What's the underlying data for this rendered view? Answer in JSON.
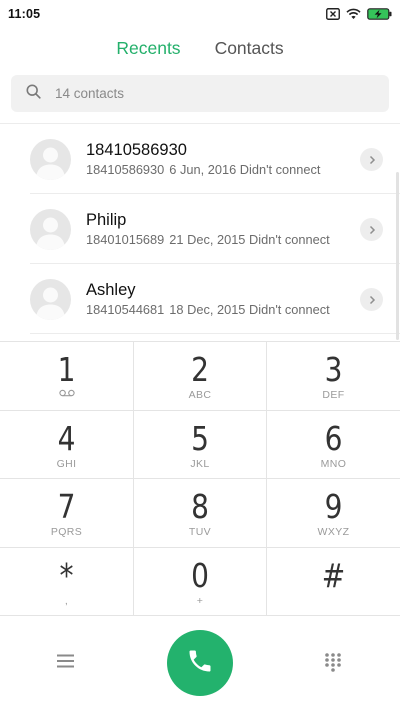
{
  "status_bar": {
    "time": "11:05",
    "icons": [
      "no-sim-icon",
      "wifi-icon",
      "battery-charging-icon"
    ]
  },
  "tabs": [
    {
      "label": "Recents",
      "active": true
    },
    {
      "label": "Contacts",
      "active": false
    }
  ],
  "search": {
    "placeholder": "14 contacts",
    "icon": "search-icon"
  },
  "recents": [
    {
      "name": "18410586930",
      "number": "18410586930",
      "date": "6 Jun, 2016",
      "status": "Didn't connect"
    },
    {
      "name": "Philip",
      "number": "18401015689",
      "date": "21 Dec, 2015",
      "status": "Didn't connect"
    },
    {
      "name": "Ashley",
      "number": "18410544681",
      "date": "18 Dec, 2015",
      "status": "Didn't connect"
    }
  ],
  "keypad": [
    {
      "digit": "1",
      "letters": "",
      "sub_icon": "voicemail-icon"
    },
    {
      "digit": "2",
      "letters": "ABC"
    },
    {
      "digit": "3",
      "letters": "DEF"
    },
    {
      "digit": "4",
      "letters": "GHI"
    },
    {
      "digit": "5",
      "letters": "JKL"
    },
    {
      "digit": "6",
      "letters": "MNO"
    },
    {
      "digit": "7",
      "letters": "PQRS"
    },
    {
      "digit": "8",
      "letters": "TUV"
    },
    {
      "digit": "9",
      "letters": "WXYZ"
    },
    {
      "digit": "*",
      "letters": ","
    },
    {
      "digit": "0",
      "letters": "+"
    },
    {
      "digit": "#",
      "letters": ""
    }
  ],
  "bottom_bar": {
    "left_icon": "menu-icon",
    "center_icon": "phone-icon",
    "right_icon": "dialpad-icon"
  },
  "colors": {
    "accent": "#24b06b",
    "call_button": "#23b26d"
  }
}
